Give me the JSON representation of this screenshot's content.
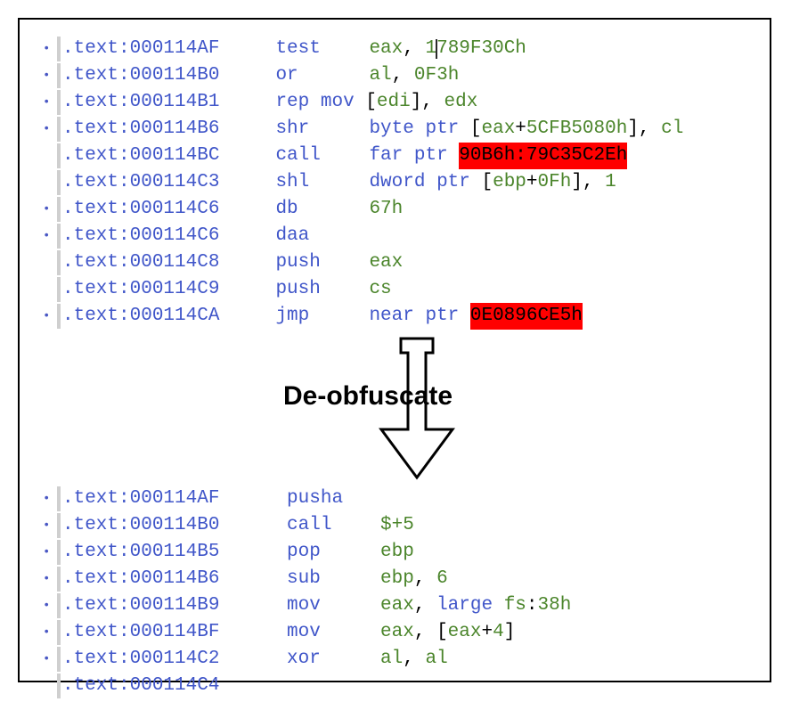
{
  "label": "De-obfuscate",
  "top": [
    {
      "dot": true,
      "addr": ".text:000114AF",
      "mnem": "test",
      "ops": [
        {
          "t": "reg",
          "v": "eax"
        },
        {
          "t": "plain",
          "v": ", "
        },
        {
          "t": "num",
          "v": "1"
        },
        {
          "t": "caret"
        },
        {
          "t": "num",
          "v": "789F30Ch"
        }
      ]
    },
    {
      "dot": true,
      "addr": ".text:000114B0",
      "mnem": "or",
      "ops": [
        {
          "t": "reg",
          "v": "al"
        },
        {
          "t": "plain",
          "v": ", "
        },
        {
          "t": "num",
          "v": "0F3h"
        }
      ]
    },
    {
      "dot": true,
      "addr": ".text:000114B1",
      "mnem": "rep mov",
      "nowidth": true,
      "ops": [
        {
          "t": "plain",
          "v": " ["
        },
        {
          "t": "reg",
          "v": "edi"
        },
        {
          "t": "plain",
          "v": "], "
        },
        {
          "t": "reg",
          "v": "edx"
        }
      ]
    },
    {
      "dot": true,
      "addr": ".text:000114B6",
      "mnem": "shr",
      "ops": [
        {
          "t": "mnem",
          "v": "byte ptr "
        },
        {
          "t": "plain",
          "v": "["
        },
        {
          "t": "reg",
          "v": "eax"
        },
        {
          "t": "plain",
          "v": "+"
        },
        {
          "t": "num",
          "v": "5CFB5080h"
        },
        {
          "t": "plain",
          "v": "], "
        },
        {
          "t": "reg",
          "v": "cl"
        }
      ]
    },
    {
      "dot": false,
      "addr": ".text:000114BC",
      "mnem": "call",
      "ops": [
        {
          "t": "mnem",
          "v": "far ptr "
        },
        {
          "t": "bad",
          "v": "90B6h:79C35C2Eh"
        }
      ]
    },
    {
      "dot": false,
      "addr": ".text:000114C3",
      "mnem": "shl",
      "ops": [
        {
          "t": "mnem",
          "v": "dword ptr "
        },
        {
          "t": "plain",
          "v": "["
        },
        {
          "t": "reg",
          "v": "ebp"
        },
        {
          "t": "plain",
          "v": "+"
        },
        {
          "t": "num",
          "v": "0Fh"
        },
        {
          "t": "plain",
          "v": "], "
        },
        {
          "t": "num",
          "v": "1"
        }
      ]
    },
    {
      "dot": true,
      "addr": ".text:000114C6",
      "mnem": "db",
      "ops": [
        {
          "t": "num",
          "v": "67h"
        }
      ]
    },
    {
      "dot": true,
      "addr": ".text:000114C6",
      "mnem": "daa",
      "ops": []
    },
    {
      "dot": false,
      "addr": ".text:000114C8",
      "mnem": "push",
      "ops": [
        {
          "t": "reg",
          "v": "eax"
        }
      ]
    },
    {
      "dot": false,
      "addr": ".text:000114C9",
      "mnem": "push",
      "ops": [
        {
          "t": "reg",
          "v": "cs"
        }
      ]
    },
    {
      "dot": true,
      "addr": ".text:000114CA",
      "mnem": "jmp",
      "ops": [
        {
          "t": "mnem",
          "v": "near ptr "
        },
        {
          "t": "bad",
          "v": "0E0896CE5h"
        }
      ]
    }
  ],
  "bottom": [
    {
      "dot": true,
      "addr": ".text:000114AF",
      "mnem": "pusha",
      "ops": []
    },
    {
      "dot": true,
      "addr": ".text:000114B0",
      "mnem": "call",
      "ops": [
        {
          "t": "num",
          "v": "$+5"
        }
      ]
    },
    {
      "dot": true,
      "addr": ".text:000114B5",
      "mnem": "pop",
      "ops": [
        {
          "t": "reg",
          "v": "ebp"
        }
      ]
    },
    {
      "dot": true,
      "addr": ".text:000114B6",
      "mnem": "sub",
      "ops": [
        {
          "t": "reg",
          "v": "ebp"
        },
        {
          "t": "plain",
          "v": ", "
        },
        {
          "t": "num",
          "v": "6"
        }
      ]
    },
    {
      "dot": true,
      "addr": ".text:000114B9",
      "mnem": "mov",
      "ops": [
        {
          "t": "reg",
          "v": "eax"
        },
        {
          "t": "plain",
          "v": ", "
        },
        {
          "t": "mnem",
          "v": "large "
        },
        {
          "t": "reg",
          "v": "fs"
        },
        {
          "t": "plain",
          "v": ":"
        },
        {
          "t": "num",
          "v": "38h"
        }
      ]
    },
    {
      "dot": true,
      "addr": ".text:000114BF",
      "mnem": "mov",
      "ops": [
        {
          "t": "reg",
          "v": "eax"
        },
        {
          "t": "plain",
          "v": ", ["
        },
        {
          "t": "reg",
          "v": "eax"
        },
        {
          "t": "plain",
          "v": "+"
        },
        {
          "t": "num",
          "v": "4"
        },
        {
          "t": "plain",
          "v": "]"
        }
      ]
    },
    {
      "dot": true,
      "addr": ".text:000114C2",
      "mnem": "xor",
      "ops": [
        {
          "t": "reg",
          "v": "al"
        },
        {
          "t": "plain",
          "v": ", "
        },
        {
          "t": "reg",
          "v": "al"
        }
      ]
    },
    {
      "dot": false,
      "addr": ".text:000114C4",
      "mnem": "",
      "ops": []
    }
  ]
}
